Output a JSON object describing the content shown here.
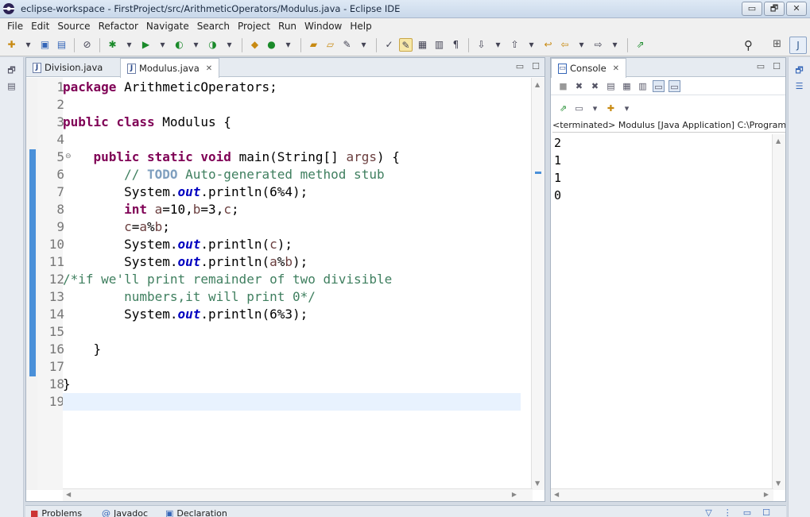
{
  "window": {
    "title": "eclipse-workspace - FirstProject/src/ArithmeticOperators/Modulus.java - Eclipse IDE",
    "minimize": "▭",
    "restore": "🗗",
    "close": "✕"
  },
  "menu": [
    "File",
    "Edit",
    "Source",
    "Refactor",
    "Navigate",
    "Search",
    "Project",
    "Run",
    "Window",
    "Help"
  ],
  "editor": {
    "tabs": [
      {
        "label": "Division.java",
        "active": false
      },
      {
        "label": "Modulus.java",
        "active": true
      }
    ],
    "line_numbers": [
      "1",
      "2",
      "3",
      "4",
      "5",
      "6",
      "7",
      "8",
      "9",
      "10",
      "11",
      "12",
      "13",
      "14",
      "15",
      "16",
      "17",
      "18",
      "19"
    ],
    "current_line": 19
  },
  "console": {
    "tab_label": "Console",
    "status": "<terminated> Modulus [Java Application] C:\\Program F",
    "output": [
      "2",
      "1",
      "1",
      "0"
    ]
  },
  "bottom_tabs": [
    "Problems",
    "Javadoc",
    "Declaration"
  ]
}
